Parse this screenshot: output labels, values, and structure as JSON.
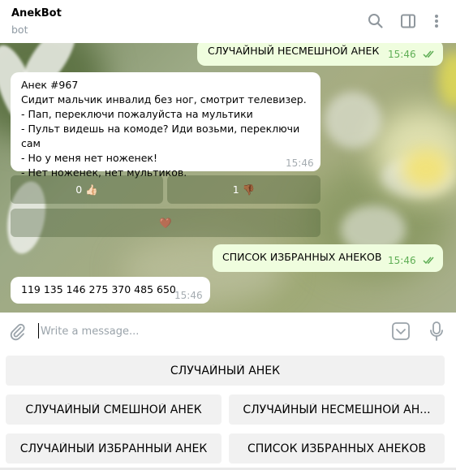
{
  "header": {
    "title": "AnekBot",
    "subtitle": "bot"
  },
  "messages": {
    "out1": {
      "text": "СЛУЧАЙНЫЙ НЕСМЕШНОЙ АНЕК",
      "time": "15:46"
    },
    "in1": {
      "lines": [
        "Анек #967",
        "Сидит мальчик инвалид без ног, смотрит телевизер.",
        "- Пап, переключи пожалуйста на мультики",
        "- Пульт видешь на комоде? Иди возьми, переключи сам",
        "- Но у меня нет ноженек!",
        "- Нет ноженек, нет мультиков."
      ],
      "time": "15:46"
    },
    "inline_buttons": {
      "like": "0 👍🏻",
      "dislike": "1 👎🏾",
      "favorite": "🤎"
    },
    "out2": {
      "text": "СПИСОК ИЗБРАННЫХ АНЕКОВ",
      "time": "15:46"
    },
    "in2": {
      "text": "119 135 146 275 370 485 650",
      "time": "15:46"
    }
  },
  "input": {
    "placeholder": "Write a message..."
  },
  "reply_keyboard": {
    "random": "СЛУЧАЙНЫЙ АНЕК",
    "random_funny": "СЛУЧАЙНЫЙ СМЕШНОЙ АНЕК",
    "random_unfunny": "СЛУЧАЙНЫЙ НЕСМЕШНОЙ АН...",
    "random_favorite": "СЛУЧАЙНЫЙ ИЗБРАННЫЙ АНЕК",
    "favorites_list": "СПИСОК ИЗБРАННЫХ АНЕКОВ"
  },
  "icons": {
    "search": "search-icon",
    "sidebar": "sidebar-toggle-icon",
    "more": "more-vertical-icon",
    "attach": "paperclip-icon",
    "keyboard": "keyboard-toggle-icon",
    "mic": "microphone-icon"
  },
  "colors": {
    "outgoing_bubble": "#effdde",
    "incoming_bubble": "#ffffff",
    "read_check": "#5fae55"
  }
}
